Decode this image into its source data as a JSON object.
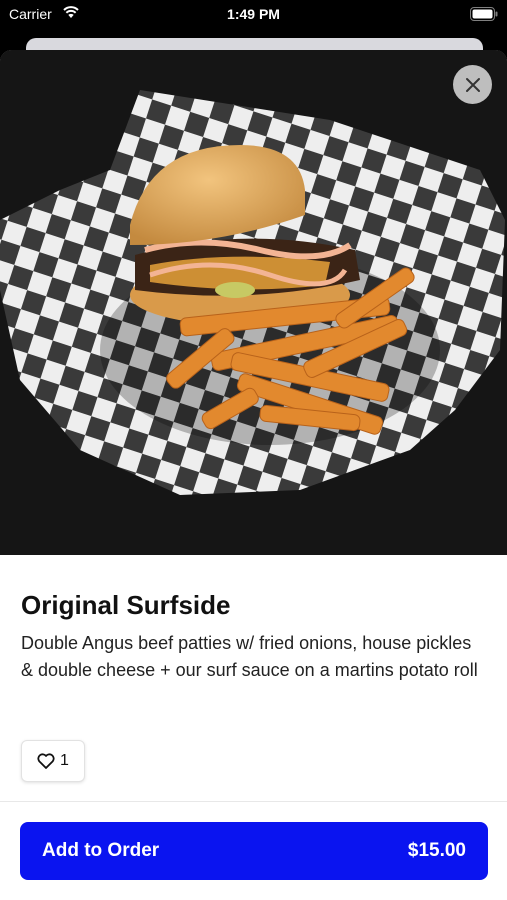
{
  "status_bar": {
    "carrier": "Carrier",
    "time": "1:49 PM"
  },
  "item": {
    "title": "Original Surfside",
    "description": "Double Angus beef patties w/ fried onions, house pickles & double cheese + our surf sauce on a martins potato roll",
    "like_count": "1",
    "image_subject": "burger-and-fries-in-checkered-basket"
  },
  "actions": {
    "add_label": "Add to Order",
    "price": "$15.00",
    "close_icon": "close-icon",
    "like_icon": "heart-icon"
  },
  "colors": {
    "primary_button": "#0a14f0",
    "background": "#000000",
    "sheet": "#ffffff"
  }
}
